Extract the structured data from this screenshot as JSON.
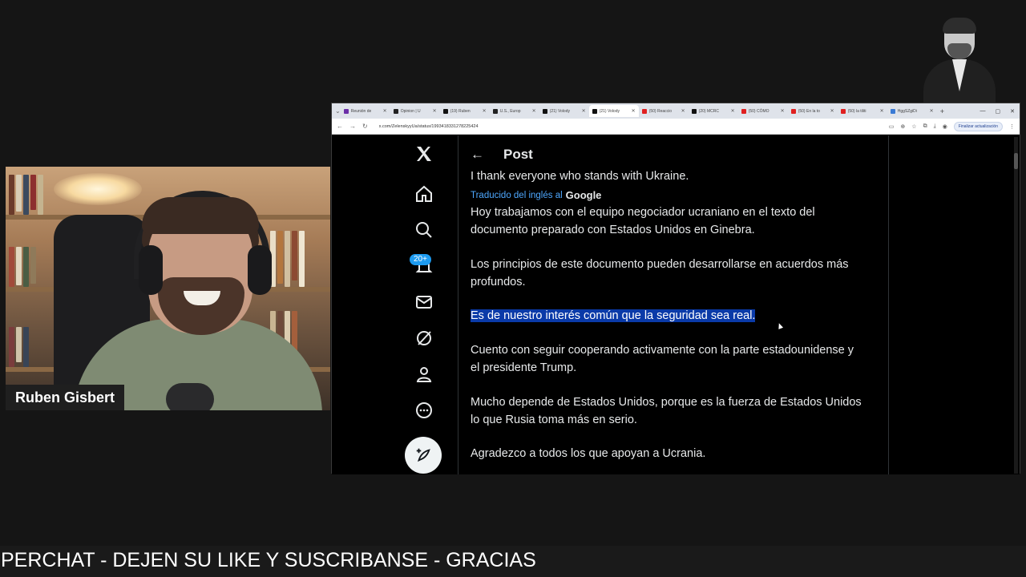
{
  "presenter": {
    "name": "Ruben Gisbert"
  },
  "browser": {
    "tabs": [
      {
        "label": "Reunión de",
        "color": "#6b2fa8"
      },
      {
        "label": "Opinion | U",
        "color": "#222222"
      },
      {
        "label": "(19) Ruben",
        "color": "#111111"
      },
      {
        "label": "U.S., Europ",
        "color": "#222222"
      },
      {
        "label": "(21) Volody",
        "color": "#111111"
      },
      {
        "label": "(21) Volody",
        "color": "#111111",
        "active": true
      },
      {
        "label": "(50) Reaccio",
        "color": "#e02020"
      },
      {
        "label": "(20) MCRC",
        "color": "#111111"
      },
      {
        "label": "(50) CÓMO",
        "color": "#e02020"
      },
      {
        "label": "(50) En la to",
        "color": "#e02020"
      },
      {
        "label": "(50) la tiliti",
        "color": "#e02020"
      },
      {
        "label": "HggSZgiDi",
        "color": "#3a7bd5"
      }
    ],
    "url": "x.com/ZelenskyyUa/status/1993418331278225424",
    "update_button": "Finalizar actualización"
  },
  "x": {
    "header_title": "Post",
    "notifications_badge": "20+",
    "nav_icons": [
      "x-logo-icon",
      "home-icon",
      "search-icon",
      "notifications-icon",
      "messages-icon",
      "grok-icon",
      "profile-icon",
      "more-icon"
    ],
    "original_last_line": "I thank everyone who stands with Ukraine.",
    "translated_label": "Traducido del inglés al",
    "translated_brand": "Google",
    "paragraphs": [
      "Hoy trabajamos con el equipo negociador ucraniano en el texto del documento preparado con Estados Unidos en Ginebra.",
      "Los principios de este documento pueden desarrollarse en acuerdos más profundos.",
      "Es de nuestro interés común que la seguridad sea real.",
      "Cuento con seguir cooperando activamente con la parte estadounidense y el presidente Trump.",
      "Mucho depende de Estados Unidos, porque es la fuerza de Estados Unidos lo que Rusia toma más en serio.",
      "Agradezco a todos los que apoyan a Ucrania."
    ],
    "highlight_color": "#0a3aa8"
  },
  "ticker": {
    "text": "PERCHAT - DEJEN SU LIKE Y SUSCRIBANSE - GRACIAS"
  }
}
